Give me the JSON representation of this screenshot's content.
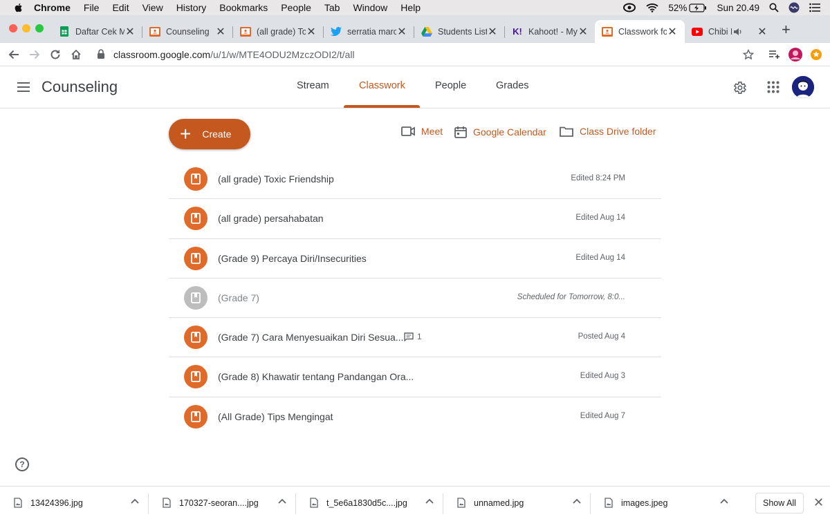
{
  "menubar": {
    "app": "Chrome",
    "items": [
      "File",
      "Edit",
      "View",
      "History",
      "Bookmarks",
      "People",
      "Tab",
      "Window",
      "Help"
    ],
    "battery": "52%",
    "clock": "Sun 20.49"
  },
  "tabs": [
    {
      "title": "Daftar Cek M",
      "icon": "sheets-icon",
      "color": "#0f9d58"
    },
    {
      "title": "Counseling",
      "icon": "classroom-icon",
      "color": "#e06a2a"
    },
    {
      "title": "(all grade) To",
      "icon": "classroom-icon",
      "color": "#e06a2a"
    },
    {
      "title": "serratia marc",
      "icon": "twitter-icon",
      "color": "#1da1f2"
    },
    {
      "title": "Students List",
      "icon": "drive-icon",
      "color": "#fbbc04"
    },
    {
      "title": "Kahoot! - My",
      "icon": "kahoot-icon",
      "color": "#46178f"
    },
    {
      "title": "Classwork fo",
      "icon": "classroom-icon",
      "color": "#e06a2a",
      "active": true
    },
    {
      "title": "Chibi Ma",
      "icon": "youtube-icon",
      "color": "#ff0000"
    }
  ],
  "address": {
    "host": "classroom.google.com",
    "path": "/u/1/w/MTE4ODU2MzczODI2/t/all"
  },
  "header": {
    "class_name": "Counseling",
    "nav": [
      "Stream",
      "Classwork",
      "People",
      "Grades"
    ],
    "active_nav": "Classwork"
  },
  "actions": {
    "create": "Create",
    "meet": "Meet",
    "calendar": "Google Calendar",
    "drive": "Class Drive folder"
  },
  "colors": {
    "accent": "#c5581e",
    "item_icon": "#e06a2a",
    "scheduled_icon": "#bdbdbd"
  },
  "items": [
    {
      "title": "(all grade) Toxic Friendship",
      "status": "Edited 8:24 PM"
    },
    {
      "title": "(all grade) persahabatan",
      "status": "Edited Aug 14"
    },
    {
      "title": "(Grade 9) Percaya Diri/Insecurities",
      "status": "Edited Aug 14"
    },
    {
      "title": "(Grade 7)",
      "status": "Scheduled for Tomorrow, 8:0...",
      "scheduled": true
    },
    {
      "title": "(Grade 7) Cara Menyesuaikan Diri Sesua...",
      "status": "Posted Aug 4",
      "comments": "1"
    },
    {
      "title": "(Grade 8) Khawatir tentang Pandangan Ora...",
      "status": "Edited Aug 3"
    },
    {
      "title": "(All Grade) Tips Mengingat",
      "status": "Edited Aug 7"
    }
  ],
  "downloads": {
    "files": [
      "13424396.jpg",
      "170327-seoran....jpg",
      "t_5e6a1830d5c....jpg",
      "unnamed.jpg",
      "images.jpeg"
    ],
    "show_all": "Show All"
  }
}
